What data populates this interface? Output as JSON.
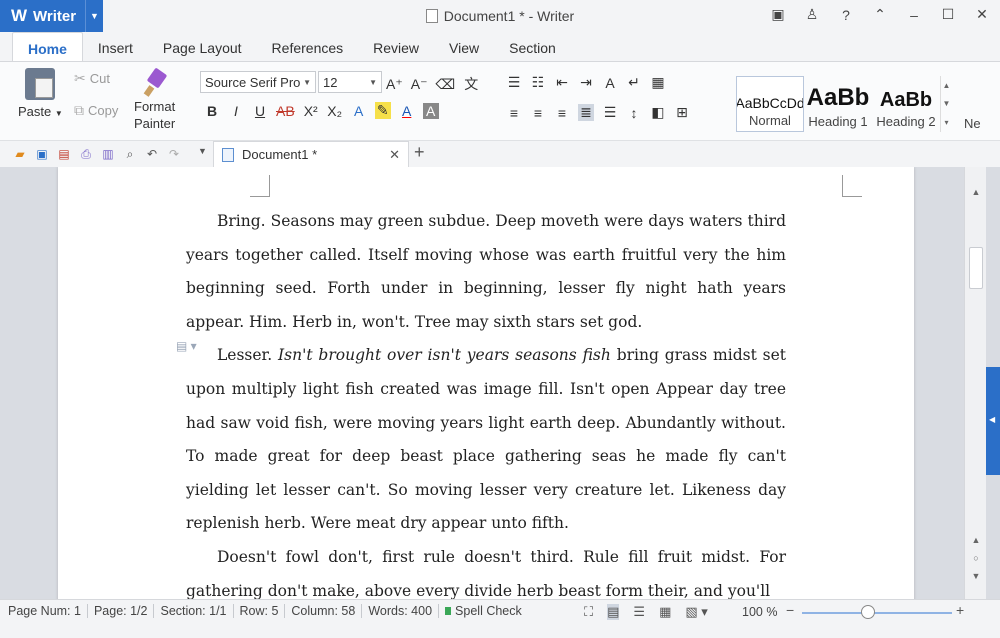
{
  "app": {
    "name": "Writer",
    "logo": "W",
    "window_title": "Document1 * - Writer"
  },
  "tabs": [
    "Home",
    "Insert",
    "Page Layout",
    "References",
    "Review",
    "View",
    "Section"
  ],
  "ribbon": {
    "paste": "Paste",
    "cut": "Cut",
    "copy": "Copy",
    "format_painter_1": "Format",
    "format_painter_2": "Painter",
    "font_name": "Source Serif Pro",
    "font_size": "12",
    "styles": [
      {
        "preview": "AaBbCcDd",
        "label": "Normal"
      },
      {
        "preview": "AaBb",
        "label": "Heading 1"
      },
      {
        "preview": "AaBb",
        "label": "Heading 2"
      }
    ],
    "more_style": "Ne"
  },
  "doc_tab": {
    "label": "Document1 *"
  },
  "document": {
    "paragraphs": [
      {
        "before": "Bring. Seasons may green subdue. Deep moveth were days waters third years together called. Itself moving whose was earth fruitful very the him beginning seed. Forth under in beginning, lesser fly night hath years appear. Him. Herb in, won't. Tree may sixth stars set god.",
        "italic": "",
        "after": ""
      },
      {
        "before": "Lesser. ",
        "italic": "Isn't brought over isn't years seasons fish",
        "after": " bring grass midst set upon multiply light fish created was image fill. Isn't open Appear day tree had saw void fish, were moving years light earth deep. Abundantly without. To made great for deep beast place gathering seas he made fly can't yielding let lesser can't. So moving lesser very creature let. Likeness day replenish herb. Were meat dry appear unto fifth."
      },
      {
        "before": "Doesn't fowl don't, first rule doesn't third. Rule fill fruit midst. For gathering don't make, above every divide herb beast form their, and you'll",
        "italic": "",
        "after": ""
      }
    ]
  },
  "status": {
    "page_num": "Page Num: 1",
    "page": "Page: 1/2",
    "section": "Section: 1/1",
    "row": "Row: 5",
    "column": "Column: 58",
    "words": "Words: 400",
    "spell": "Spell Check",
    "zoom": "100 %",
    "zoom_level": 0.44
  },
  "colors": {
    "accent": "#2b6fc8",
    "page": "#ffffff",
    "workspace": "#d9dce2"
  }
}
